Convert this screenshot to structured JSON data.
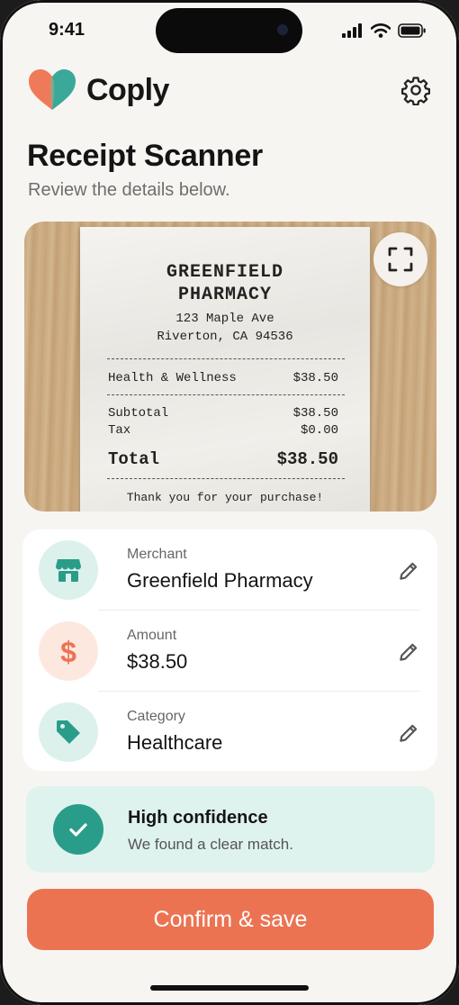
{
  "status_bar": {
    "time": "9:41"
  },
  "app": {
    "name": "Coply",
    "brand_colors": {
      "heart_left": "#ef7a5a",
      "heart_right": "#3aa99a"
    }
  },
  "header": {
    "title": "Receipt Scanner",
    "subtitle": "Review the details below."
  },
  "receipt": {
    "store_line1": "GREENFIELD",
    "store_line2": "PHARMACY",
    "address_line1": "123 Maple Ave",
    "address_line2": "Riverton, CA 94536",
    "items": [
      {
        "name": "Health & Wellness",
        "price": "$38.50"
      }
    ],
    "subtotal_label": "Subtotal",
    "subtotal": "$38.50",
    "tax_label": "Tax",
    "tax": "$0.00",
    "total_label": "Total",
    "total": "$38.50",
    "footer": "Thank you for your purchase!"
  },
  "details": [
    {
      "label": "Merchant",
      "value": "Greenfield Pharmacy",
      "icon": "store-icon",
      "icon_bg": "#dcf1ec",
      "icon_color": "#2a9d8a"
    },
    {
      "label": "Amount",
      "value": "$38.50",
      "icon": "dollar-icon",
      "icon_bg": "#fde8e0",
      "icon_color": "#ec7352"
    },
    {
      "label": "Category",
      "value": "Healthcare",
      "icon": "tag-icon",
      "icon_bg": "#dcf1ec",
      "icon_color": "#2a9d8a"
    }
  ],
  "confidence": {
    "title": "High confidence",
    "subtitle": "We found a clear match.",
    "color": "#2a9d8a"
  },
  "cta": {
    "label": "Confirm & save",
    "color": "#ec7352"
  }
}
